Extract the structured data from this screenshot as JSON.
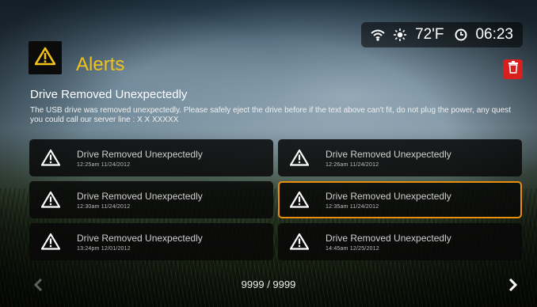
{
  "status": {
    "wifi_icon": "wifi-icon",
    "weather_icon": "sun-icon",
    "temperature": "72'F",
    "clock_icon": "clock-icon",
    "time": "06:23"
  },
  "header": {
    "badge_icon": "warning-icon",
    "title": "Alerts",
    "delete_icon": "trash-icon"
  },
  "detail": {
    "title": "Drive Removed Unexpectedly",
    "message": "The USB drive was removed unexpectedly.  Please safely eject the drive before if the text above can't fit, do not plug the power, any quest you could call our server line : X X XXXXX"
  },
  "alerts": [
    {
      "title": "Drive Removed Unexpectedly",
      "timestamp": "12:25am  11/24/2012"
    },
    {
      "title": "Drive Removed Unexpectedly",
      "timestamp": "12:26am  11/24/2012"
    },
    {
      "title": "Drive Removed Unexpectedly",
      "timestamp": "12:30am  11/24/2012"
    },
    {
      "title": "Drive Removed Unexpectedly",
      "timestamp": "12:35am  11/24/2012"
    },
    {
      "title": "Drive Removed Unexpectedly",
      "timestamp": "13:24pm  12/01/2012"
    },
    {
      "title": "Drive Removed Unexpectedly",
      "timestamp": "14:45am  12/25/2012"
    }
  ],
  "pager": {
    "text": "9999 / 9999"
  },
  "colors": {
    "accent_yellow": "#f2c21a",
    "selection_orange": "#e8900e",
    "delete_red": "#d81f1f"
  }
}
